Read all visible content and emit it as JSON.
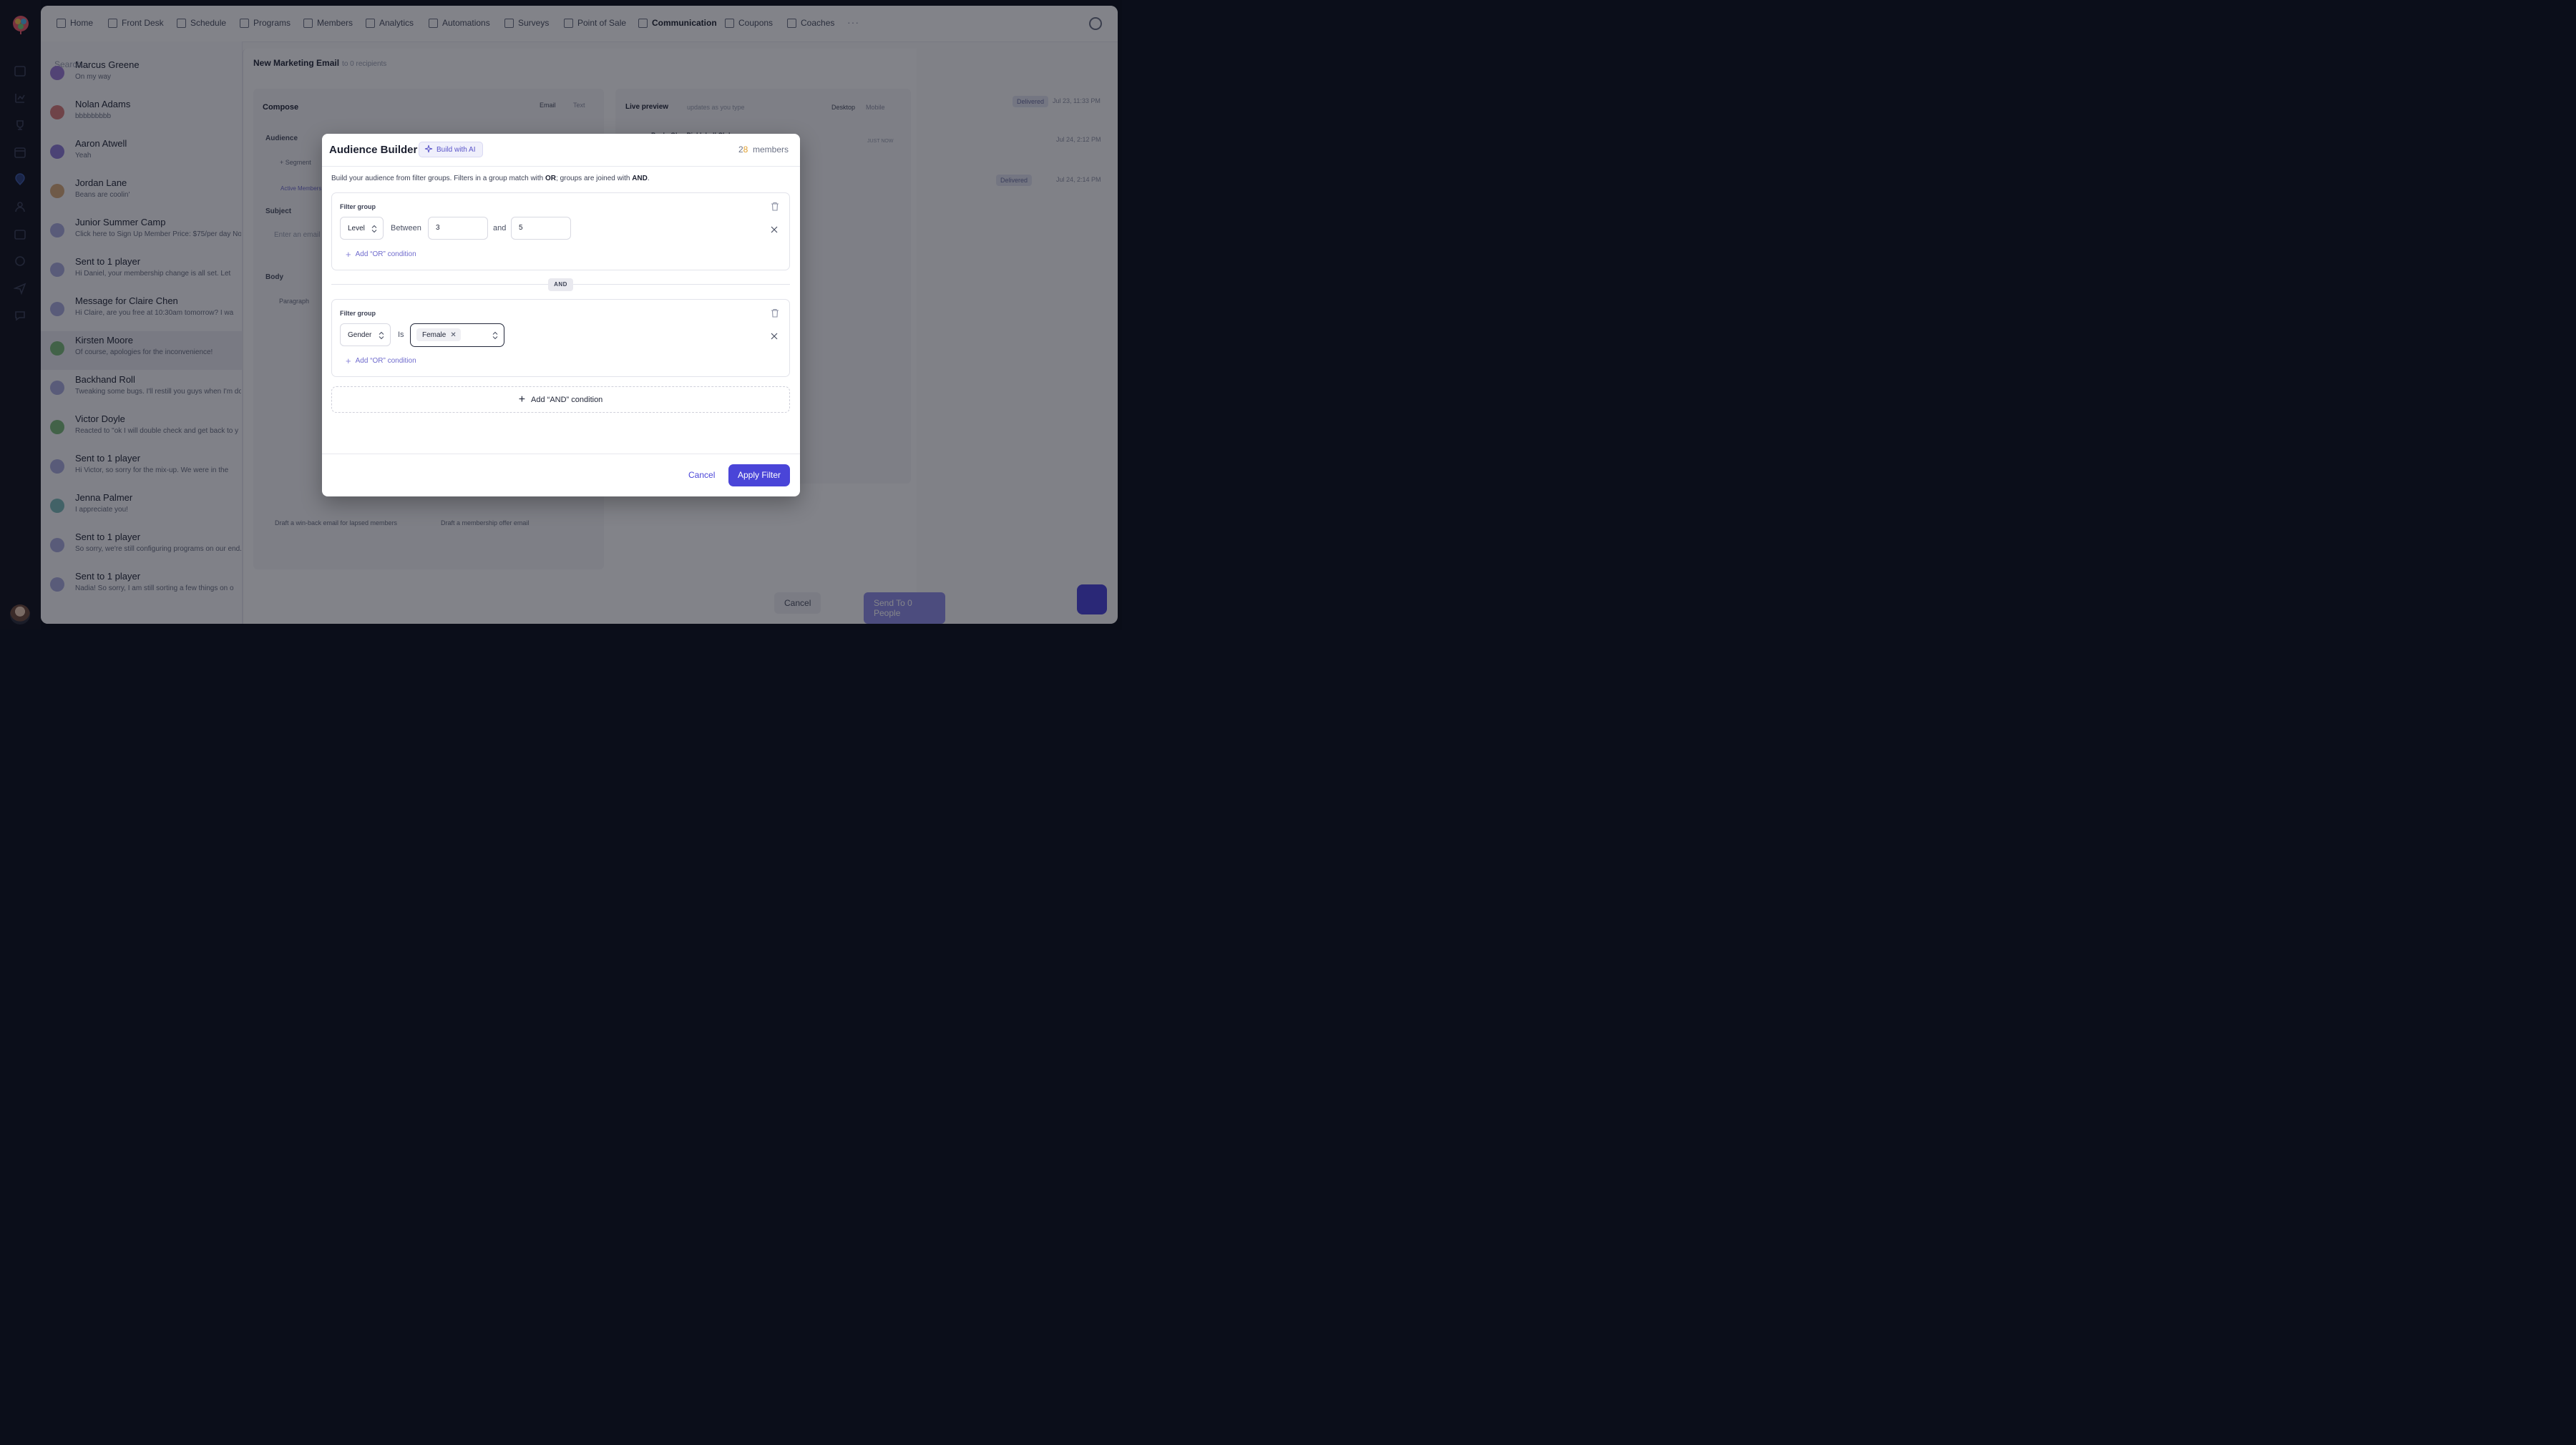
{
  "topnav": {
    "items": [
      "Home",
      "Front Desk",
      "Schedule",
      "Programs",
      "Members",
      "Analytics",
      "Automations",
      "Surveys",
      "Point of Sale",
      "Communication",
      "Coupons",
      "Coaches"
    ],
    "more": "···"
  },
  "sidebar": {
    "search_placeholder": "Search...",
    "conversations": [
      {
        "name": "Marcus Greene",
        "preview": "On my way",
        "color": "#9b7bd4"
      },
      {
        "name": "Nolan Adams",
        "preview": "bbbbbbbbb",
        "color": "#d47b7b"
      },
      {
        "name": "Aaron Atwell",
        "preview": "Yeah",
        "color": "#8c7bd4"
      },
      {
        "name": "Jordan Lane",
        "preview": "Beans are coolin'",
        "color": "#d4a87b"
      },
      {
        "name": "Junior Summer Camp",
        "preview": "Click here to Sign Up Member Price: $75/per day Non",
        "color": "#a8aadc"
      },
      {
        "name": "Sent to 1 player",
        "preview": "Hi Daniel, your membership change is all set. Let",
        "color": "#a8aadc"
      },
      {
        "name": "Message for Claire Chen",
        "preview": "Hi Claire, are you free at 10:30am tomorrow? I wa",
        "color": "#a8aadc"
      },
      {
        "name": "Kirsten Moore",
        "preview": "Of course, apologies for the inconvenience!",
        "color": "#7bb87b"
      },
      {
        "name": "Backhand Roll",
        "preview": "Tweaking some bugs. I'll restill you guys when I'm do",
        "color": "#a8aadc"
      },
      {
        "name": "Victor Doyle",
        "preview": "Reacted to \"ok I will double check and get back to y",
        "color": "#7bb87b"
      },
      {
        "name": "Sent to 1 player",
        "preview": "Hi Victor, so sorry for the mix-up. We were in the",
        "color": "#a8aadc"
      },
      {
        "name": "Jenna Palmer",
        "preview": "I appreciate you!",
        "color": "#7bb8b8"
      },
      {
        "name": "Sent to 1 player",
        "preview": "So sorry, we're still configuring programs on our end.",
        "color": "#a8aadc"
      },
      {
        "name": "Sent to 1 player",
        "preview": "Nadia! So sorry, I am still sorting a few things on o",
        "color": "#a8aadc"
      }
    ]
  },
  "compose": {
    "title": "New Marketing Email",
    "subtitle": "to 0 recipients",
    "tab_compose": "Compose",
    "tab_email": "Email",
    "tab_text": "Text",
    "audience_label": "Audience",
    "segment_btn": "+ Segment",
    "active_members": "Active Members",
    "subject_label": "Subject",
    "subject_placeholder": "Enter an email",
    "body_label": "Body",
    "paragraph": "Paragraph",
    "live_preview": "Live preview",
    "live_preview_sub": "updates as you type",
    "desktop": "Desktop",
    "mobile": "Mobile",
    "club_name": "Paolo Glen Pickleball Club",
    "just_now": "JUST NOW",
    "suggestion1": "Draft a win-back email for lapsed members",
    "suggestion2": "Draft a membership offer email",
    "cancel": "Cancel",
    "send": "Send To 0 People",
    "meta1": "Jul 23, 11:33 PM",
    "meta2": "Jul 24, 2:12 PM",
    "meta3": "Jul 24, 2:14 PM",
    "badge_delivered": "Delivered"
  },
  "modal": {
    "title": "Audience Builder",
    "ai_button": "Build with AI",
    "member_count_a": "2",
    "member_count_b": "8",
    "member_count_label": "members",
    "description_pre": "Build your audience from filter groups. Filters in a group match with ",
    "description_or": "OR",
    "description_mid": "; groups are joined with ",
    "description_and": "AND",
    "description_end": ".",
    "group_label": "Filter group",
    "group1": {
      "field": "Level",
      "operator": "Between",
      "value_from": "3",
      "joiner": "and",
      "value_to": "5",
      "add_or": "Add “OR” condition"
    },
    "separator": "AND",
    "group2": {
      "field": "Gender",
      "operator": "Is",
      "chip": "Female",
      "add_or": "Add “OR” condition"
    },
    "add_and": "Add “AND” condition",
    "cancel": "Cancel",
    "apply": "Apply Filter"
  }
}
